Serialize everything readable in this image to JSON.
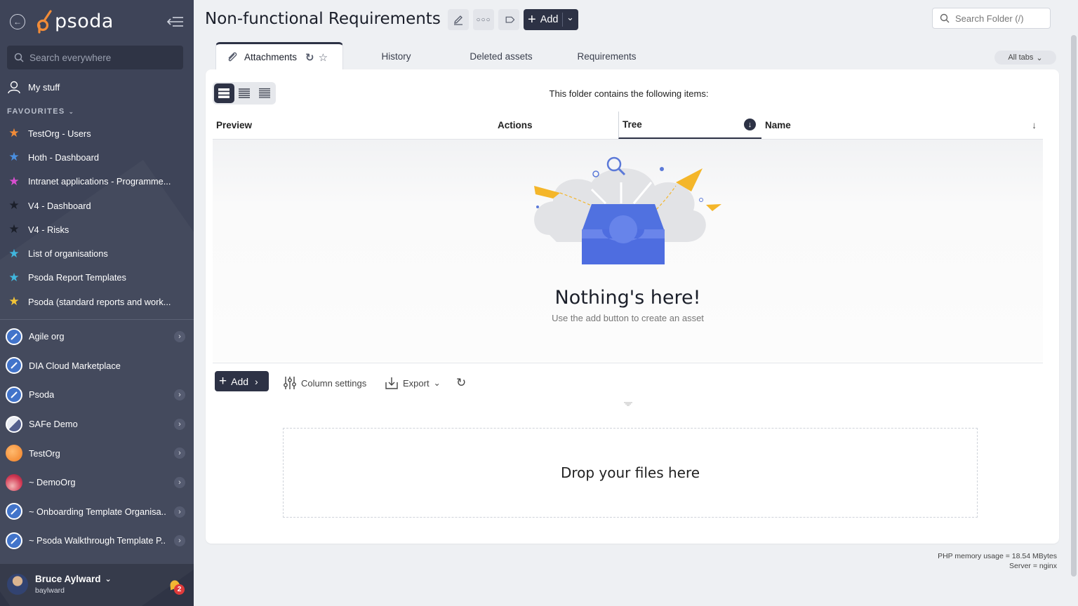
{
  "app": {
    "name": "psoda"
  },
  "sidebar": {
    "search_placeholder": "Search everywhere",
    "my_stuff": "My stuff",
    "favourites_label": "FAVOURITES",
    "favourites": [
      {
        "label": "TestOrg - Users",
        "color": "#f28c38"
      },
      {
        "label": "Hoth - Dashboard",
        "color": "#4a8fe0"
      },
      {
        "label": "Intranet applications - Programme...",
        "color": "#d94fd0"
      },
      {
        "label": "V4 - Dashboard",
        "color": "#1b1f2a"
      },
      {
        "label": "V4 - Risks",
        "color": "#1b1f2a"
      },
      {
        "label": "List of organisations",
        "color": "#3ab5dd"
      },
      {
        "label": "Psoda Report Templates",
        "color": "#3ab5dd"
      },
      {
        "label": "Psoda (standard reports and work...",
        "color": "#f2c230"
      }
    ],
    "orgs": [
      {
        "label": "Agile org",
        "icon": "compass-icon",
        "has_arrow": true
      },
      {
        "label": "DIA Cloud Marketplace",
        "icon": "compass-icon",
        "has_arrow": false
      },
      {
        "label": "Psoda",
        "icon": "compass-icon",
        "has_arrow": true
      },
      {
        "label": "SAFe Demo",
        "icon": "safe-logo-icon",
        "has_arrow": true
      },
      {
        "label": "TestOrg",
        "icon": "orange-circle-icon",
        "has_arrow": true
      },
      {
        "label": "~ DemoOrg",
        "icon": "sunset-icon",
        "has_arrow": true
      },
      {
        "label": "~ Onboarding Template Organisa...",
        "icon": "compass-icon",
        "has_arrow": true
      },
      {
        "label": "~ Psoda Walkthrough Template P...",
        "icon": "compass-icon",
        "has_arrow": true
      }
    ],
    "user": {
      "name": "Bruce Aylward",
      "handle": "baylward",
      "notifications": "2"
    }
  },
  "header": {
    "title": "Non-functional Requirements",
    "add_label": "Add",
    "search_placeholder": "Search Folder (/)"
  },
  "tabs": {
    "items": [
      {
        "label": "Attachments",
        "active": true
      },
      {
        "label": "History"
      },
      {
        "label": "Deleted assets"
      },
      {
        "label": "Requirements"
      }
    ],
    "all_tabs_label": "All tabs"
  },
  "main": {
    "caption": "This folder contains the following items:",
    "columns": [
      "Preview",
      "Actions",
      "Tree",
      "Name"
    ],
    "empty_title": "Nothing's here!",
    "empty_sub": "Use the add button to create an asset",
    "toolbar": {
      "add_label": "Add",
      "column_settings": "Column settings",
      "export": "Export"
    },
    "dropzone": "Drop your files here"
  },
  "footer": {
    "memory": "PHP memory usage = 18.54 MBytes",
    "server": "Server = nginx"
  },
  "colors": {
    "sidebar_bg": "#3e4458",
    "primary_dark": "#2d3245",
    "logo_orange": "#f28c38"
  }
}
